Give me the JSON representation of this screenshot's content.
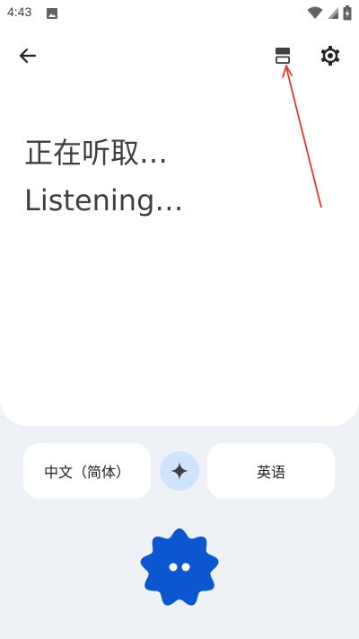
{
  "status_bar": {
    "time": "4:43",
    "icons": [
      "image-icon",
      "wifi-icon",
      "signal-icon",
      "battery-charging-icon"
    ]
  },
  "toolbar": {
    "back_icon": "arrow-left-icon",
    "layout_icon": "split-view-icon",
    "settings_icon": "gear-icon"
  },
  "transcript": {
    "source_text": "正在听取…",
    "target_text": "Listening…"
  },
  "languages": {
    "source": "中文（简体）",
    "target": "英语",
    "swap_icon": "sparkle-icon"
  },
  "mic": {
    "icon": "listening-dots-icon",
    "color": "#0b57d0"
  },
  "colors": {
    "panel": "#ffffff",
    "background": "#eef2f7",
    "swap_bg": "#cfe4fb",
    "annotation": "#e53935"
  }
}
